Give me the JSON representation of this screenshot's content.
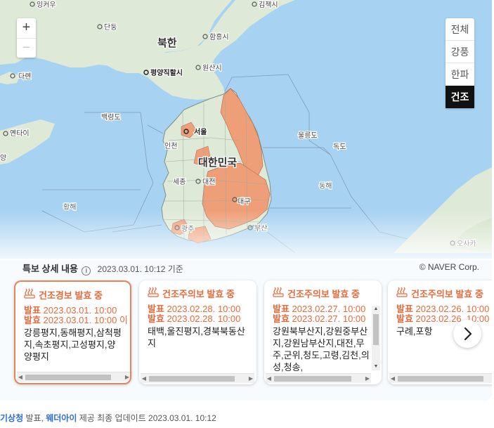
{
  "map": {
    "labels": [
      {
        "text": "잉커우",
        "cls": "city"
      },
      {
        "text": "김책시",
        "cls": "city"
      },
      {
        "text": "단둥",
        "cls": "city"
      },
      {
        "text": "북한",
        "cls": "country"
      },
      {
        "text": "함흥시",
        "cls": "city"
      },
      {
        "text": "다롄",
        "cls": "city"
      },
      {
        "text": "평양직할시",
        "cls": "capital"
      },
      {
        "text": "원산시",
        "cls": "city"
      },
      {
        "text": "백령도",
        "cls": "island"
      },
      {
        "text": "옌타이",
        "cls": "city"
      },
      {
        "text": "울릉도",
        "cls": "island"
      },
      {
        "text": "독도",
        "cls": "island"
      },
      {
        "text": "서울",
        "cls": "capital"
      },
      {
        "text": "인천",
        "cls": "city"
      },
      {
        "text": "대한민국",
        "cls": "country"
      },
      {
        "text": "세종",
        "cls": "city"
      },
      {
        "text": "대전",
        "cls": "city"
      },
      {
        "text": "동해",
        "cls": "sea"
      },
      {
        "text": "대구",
        "cls": "city"
      },
      {
        "text": "황해",
        "cls": "sea"
      },
      {
        "text": "광주",
        "cls": "city"
      },
      {
        "text": "부산",
        "cls": "city"
      },
      {
        "text": "오사카",
        "cls": "city"
      },
      {
        "text": "양",
        "cls": "city"
      }
    ]
  },
  "zoom": {
    "plus": "+",
    "minus": "−"
  },
  "categories": [
    {
      "label": "전체",
      "active": false
    },
    {
      "label": "강풍",
      "active": false
    },
    {
      "label": "한파",
      "active": false
    },
    {
      "label": "건조",
      "active": true
    }
  ],
  "info": {
    "title": "특보 상세 내용",
    "info_icon": "i",
    "date": "2023.03.01. 10:12 기준",
    "copyright": "© NAVER Corp."
  },
  "cards": [
    {
      "title": "건조경보 발효 중",
      "icon": "dry-icon",
      "announce_label": "발표",
      "announce": "2023.03.01. 10:00",
      "effective_label": "발효",
      "effective": "2023.03.01. 10:00 이",
      "regions": "강릉평지,동해평지,삼척평지,속초평지,고성평지,양양평지",
      "selected": true,
      "vscroll": false
    },
    {
      "title": "건조주의보 발효 중",
      "icon": "dry-icon",
      "announce_label": "발표",
      "announce": "2023.02.28. 10:00",
      "effective_label": "발효",
      "effective": "2023.02.28. 10:00",
      "regions": "태백,울진평지,경북북동산지",
      "selected": false,
      "vscroll": false
    },
    {
      "title": "건조주의보 발효 중",
      "icon": "dry-icon",
      "announce_label": "발표",
      "announce": "2023.02.27. 10:00",
      "effective_label": "발효",
      "effective": "2023.02.27. 10:00",
      "regions": "강원북부산지,강원중부산지,강원남부산지,대전,무주,군위,청도,고령,김천,의성,청송,",
      "selected": false,
      "vscroll": true
    },
    {
      "title": "건조주의보 발효 중",
      "icon": "dry-icon",
      "announce_label": "발표",
      "announce": "2023.02.26. 10:00",
      "effective_label": "발효",
      "effective": "2023.02.26. 10:00",
      "regions": "구례,포항",
      "selected": false,
      "vscroll": false
    }
  ],
  "footer": {
    "source": "기상청",
    "announce": " 발표, ",
    "provider": "웨더아이",
    "provide": " 제공 최종 업데이트 2023.03.01. 10:12"
  },
  "colors": {
    "sea": "#a8d2f2",
    "land": "#dfe9d8",
    "warning_region": "#ef9f78",
    "accent": "#e76a3c",
    "active_tab": "#111111"
  }
}
